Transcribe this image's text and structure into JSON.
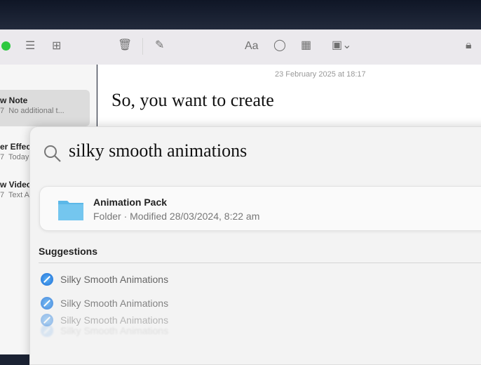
{
  "toolbar": {
    "font_label": "Aa",
    "icons": [
      "list-icon",
      "grid-icon",
      "trash-icon",
      "compose-icon",
      "checklist-icon",
      "table-icon",
      "media-icon",
      "lock-icon"
    ]
  },
  "sidebar": {
    "notes": [
      {
        "title": "w Note",
        "prefix": "7",
        "subtitle": "No additional t..."
      },
      {
        "title": "er Effec",
        "prefix": "7",
        "subtitle": "Today"
      },
      {
        "title": "w Videc",
        "prefix": "7",
        "subtitle": "Text A"
      }
    ]
  },
  "editor": {
    "date": "23 February 2025 at 18:17",
    "title": "So, you want to create"
  },
  "spotlight": {
    "query": "silky smooth animations",
    "top_result": {
      "title": "Animation Pack",
      "subtitle": "Folder · Modified 28/03/2024, 8:22 am"
    },
    "suggestions_header": "Suggestions",
    "suggestions": [
      "Silky Smooth Animations",
      "Silky Smooth Animations",
      "Silky Smooth Animations",
      "Silky Smooth Animations"
    ]
  }
}
